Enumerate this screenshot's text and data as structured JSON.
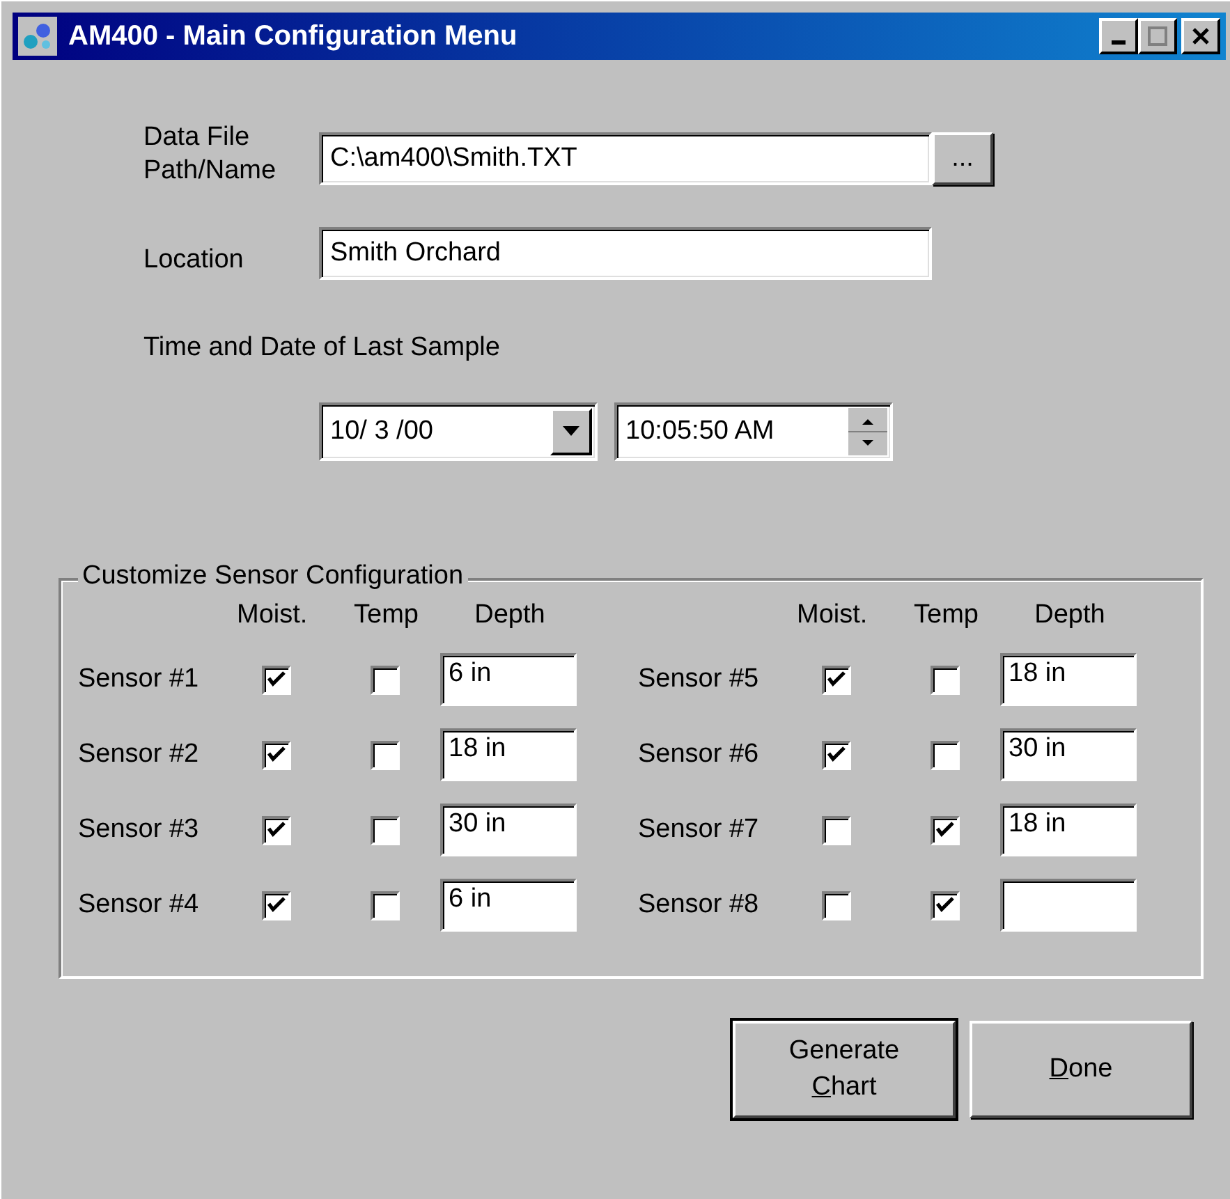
{
  "window": {
    "title": "AM400 - Main Configuration Menu"
  },
  "data_file": {
    "label_lines": [
      "Data File",
      "Path/Name"
    ],
    "value": "C:\\am400\\Smith.TXT",
    "browse_label": "..."
  },
  "location": {
    "label": "Location",
    "value": "Smith Orchard"
  },
  "last_sample": {
    "label": "Time and Date of Last Sample",
    "date": "10/ 3 /00",
    "time": "10:05:50 AM"
  },
  "sensor_group": {
    "title": "Customize Sensor Configuration",
    "halves": [
      {
        "headers": [
          "Moist.",
          "Temp",
          "Depth"
        ],
        "sensors": [
          {
            "name": "Sensor #1",
            "moist": true,
            "temp": false,
            "depth": "6 in"
          },
          {
            "name": "Sensor #2",
            "moist": true,
            "temp": false,
            "depth": "18 in"
          },
          {
            "name": "Sensor #3",
            "moist": true,
            "temp": false,
            "depth": "30 in"
          },
          {
            "name": "Sensor #4",
            "moist": true,
            "temp": false,
            "depth": "6 in"
          }
        ]
      },
      {
        "headers": [
          "Moist.",
          "Temp",
          "Depth"
        ],
        "sensors": [
          {
            "name": "Sensor #5",
            "moist": true,
            "temp": false,
            "depth": "18 in"
          },
          {
            "name": "Sensor #6",
            "moist": true,
            "temp": false,
            "depth": "30 in"
          },
          {
            "name": "Sensor #7",
            "moist": false,
            "temp": true,
            "depth": "18 in"
          },
          {
            "name": "Sensor #8",
            "moist": false,
            "temp": true
          }
        ]
      }
    ]
  },
  "buttons": [
    {
      "lines": [
        "Generate",
        "Chart"
      ],
      "default": true
    },
    {
      "lines": [
        "Done"
      ],
      "default": false
    }
  ]
}
